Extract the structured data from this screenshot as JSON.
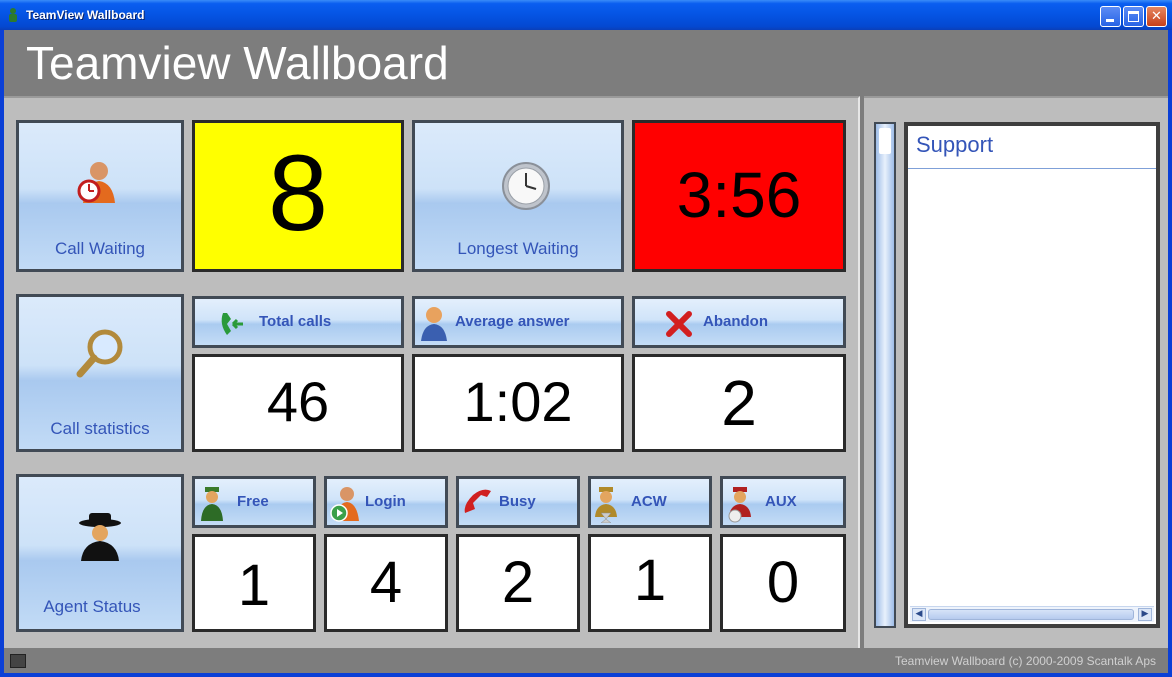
{
  "window": {
    "title": "TeamView Wallboard"
  },
  "header": {
    "title": "Teamview Wallboard"
  },
  "row1": {
    "call_waiting": {
      "label": "Call Waiting",
      "value": "8",
      "value_bg": "#ffff00"
    },
    "longest_waiting": {
      "label": "Longest Waiting",
      "value": "3:56",
      "value_bg": "#ff0000"
    }
  },
  "row2": {
    "label": "Call statistics",
    "total_calls": {
      "label": "Total calls",
      "value": "46"
    },
    "average_answer": {
      "label": "Average answer",
      "value": "1:02"
    },
    "abandon": {
      "label": "Abandon",
      "value": "2"
    }
  },
  "row3": {
    "label": "Agent Status",
    "free": {
      "label": "Free",
      "value": "1"
    },
    "login": {
      "label": "Login",
      "value": "4"
    },
    "busy": {
      "label": "Busy",
      "value": "2"
    },
    "acw": {
      "label": "ACW",
      "value": "1"
    },
    "aux": {
      "label": "AUX",
      "value": "0"
    }
  },
  "side": {
    "list_header": "Support"
  },
  "status": {
    "copyright": "Teamview Wallboard (c) 2000-2009 Scantalk Aps"
  },
  "colors": {
    "tile_text": "#3455b8",
    "waiting_bg": "#ffff00",
    "longest_bg": "#ff0000"
  }
}
